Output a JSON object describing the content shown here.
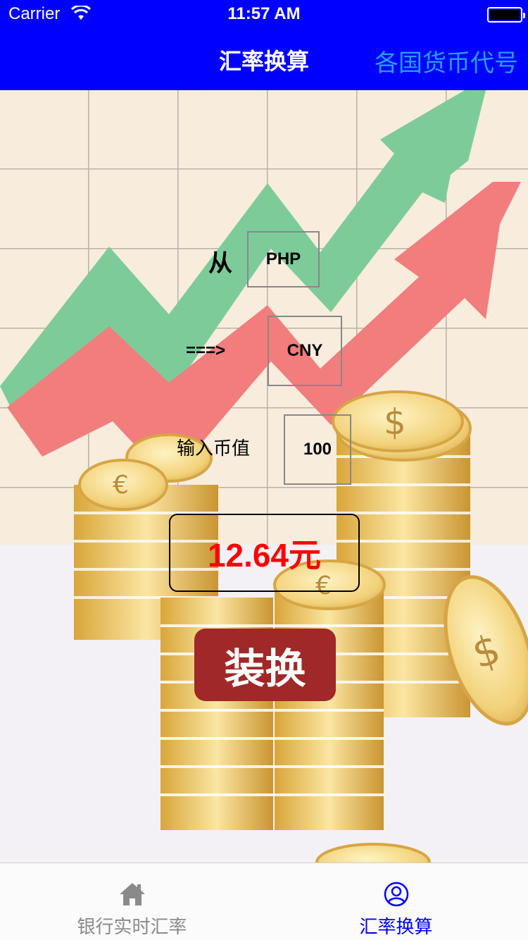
{
  "status_bar": {
    "carrier": "Carrier",
    "time": "11:57 AM"
  },
  "nav": {
    "title": "汇率换算",
    "right_button": "各国货币代号"
  },
  "form": {
    "from_label": "从",
    "from_value": "PHP",
    "to_label": "===>",
    "to_value": "CNY",
    "amount_label": "输入币值",
    "amount_value": "100",
    "result": "12.64元",
    "convert_label": "装换"
  },
  "tabs": [
    {
      "label": "银行实时汇率",
      "icon": "home-icon",
      "selected": false
    },
    {
      "label": "汇率换算",
      "icon": "user-circle-icon",
      "selected": true
    }
  ],
  "colors": {
    "nav_bg": "#0000ff",
    "accent": "#0000ff",
    "result": "#ff0000",
    "button": "#a02828"
  }
}
